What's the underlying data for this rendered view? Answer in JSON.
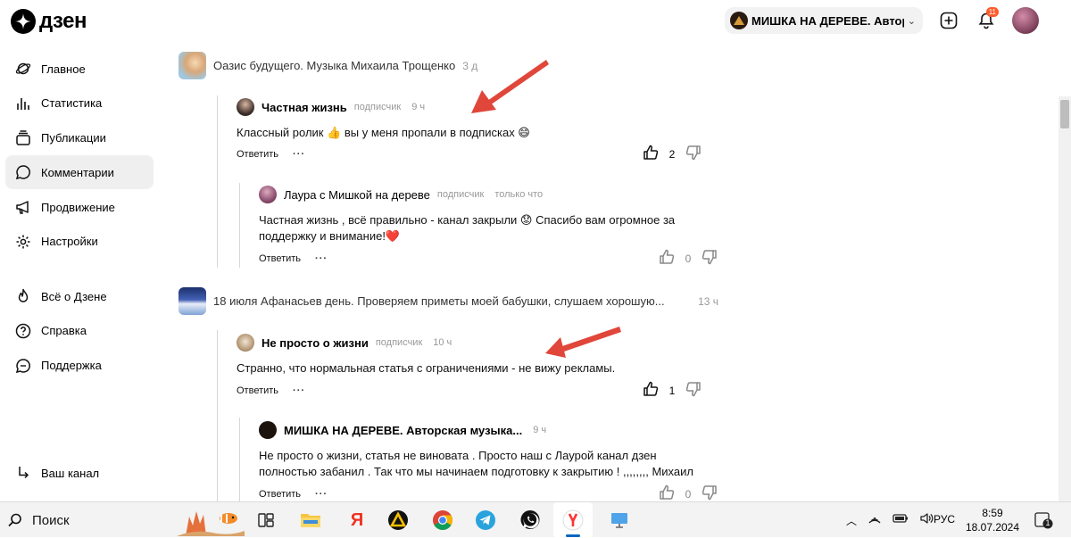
{
  "app": {
    "logo_text": "дзен"
  },
  "header": {
    "channel_name": "МИШКА НА ДЕРЕВЕ. Автор...",
    "notification_count": "11"
  },
  "sidebar": {
    "items": [
      {
        "label": "Главное",
        "icon": "planet-icon"
      },
      {
        "label": "Статистика",
        "icon": "bar-chart-icon"
      },
      {
        "label": "Публикации",
        "icon": "publications-icon"
      },
      {
        "label": "Комментарии",
        "icon": "comment-icon",
        "active": true
      },
      {
        "label": "Продвижение",
        "icon": "megaphone-icon"
      },
      {
        "label": "Настройки",
        "icon": "gear-icon"
      }
    ],
    "secondary": [
      {
        "label": "Всё о Дзене",
        "icon": "flame-icon"
      },
      {
        "label": "Справка",
        "icon": "question-icon"
      },
      {
        "label": "Поддержка",
        "icon": "support-icon"
      }
    ],
    "footer": {
      "label": "Ваш канал",
      "icon": "enter-icon"
    }
  },
  "posts": [
    {
      "title": "Оазис будущего. Музыка Михаила Трощенко",
      "time": "3 д",
      "comments": [
        {
          "author": "Частная жизнь",
          "role": "подписчик",
          "time": "9 ч",
          "text": "Классный ролик 👍 вы у меня пропали в подписках 😄",
          "likes": "2",
          "reply_label": "Ответить",
          "more": "···"
        },
        {
          "author": "Лаура с Мишкой на дереве",
          "role": "подписчик",
          "time": "только что",
          "text": "Частная жизнь , всё правильно - канал закрыли 😟 Спасибо вам огромное за поддержку и внимание!❤️",
          "likes": "0",
          "reply_label": "Ответить",
          "more": "···"
        }
      ]
    },
    {
      "title": "18 июля Афанасьев день. Проверяем приметы моей бабушки, слушаем хорошую...",
      "time": "13 ч",
      "comments": [
        {
          "author": "Не просто о жизни",
          "role": "подписчик",
          "time": "10 ч",
          "text": "Странно, что нормальная статья с ограничениями - не вижу рекламы.",
          "likes": "1",
          "reply_label": "Ответить",
          "more": "···"
        },
        {
          "author": "МИШКА НА ДЕРЕВЕ. Авторская музыка...",
          "role": "",
          "time": "9 ч",
          "text": "Не просто о жизни, статья не виновата . Просто наш с Лаурой канал дзен полностью забанил . Так что мы начинаем подготовку к закрытию ! ,,,,,,,, Михаил",
          "likes": "0",
          "reply_label": "Ответить",
          "more": "···"
        }
      ]
    }
  ],
  "taskbar": {
    "search_label": "Поиск",
    "language": "РУС",
    "time": "8:59",
    "date": "18.07.2024",
    "notification_count": "1",
    "apps": [
      "task-view-icon",
      "file-explorer-icon",
      "yandex-icon",
      "delta-icon",
      "chrome-icon",
      "telegram-icon",
      "whatsapp-icon",
      "yandex-browser-icon",
      "monitor-icon"
    ]
  },
  "colors": {
    "annotation_arrow": "#e0463a",
    "active_bg": "#efefef",
    "accent": "#0067c0"
  }
}
